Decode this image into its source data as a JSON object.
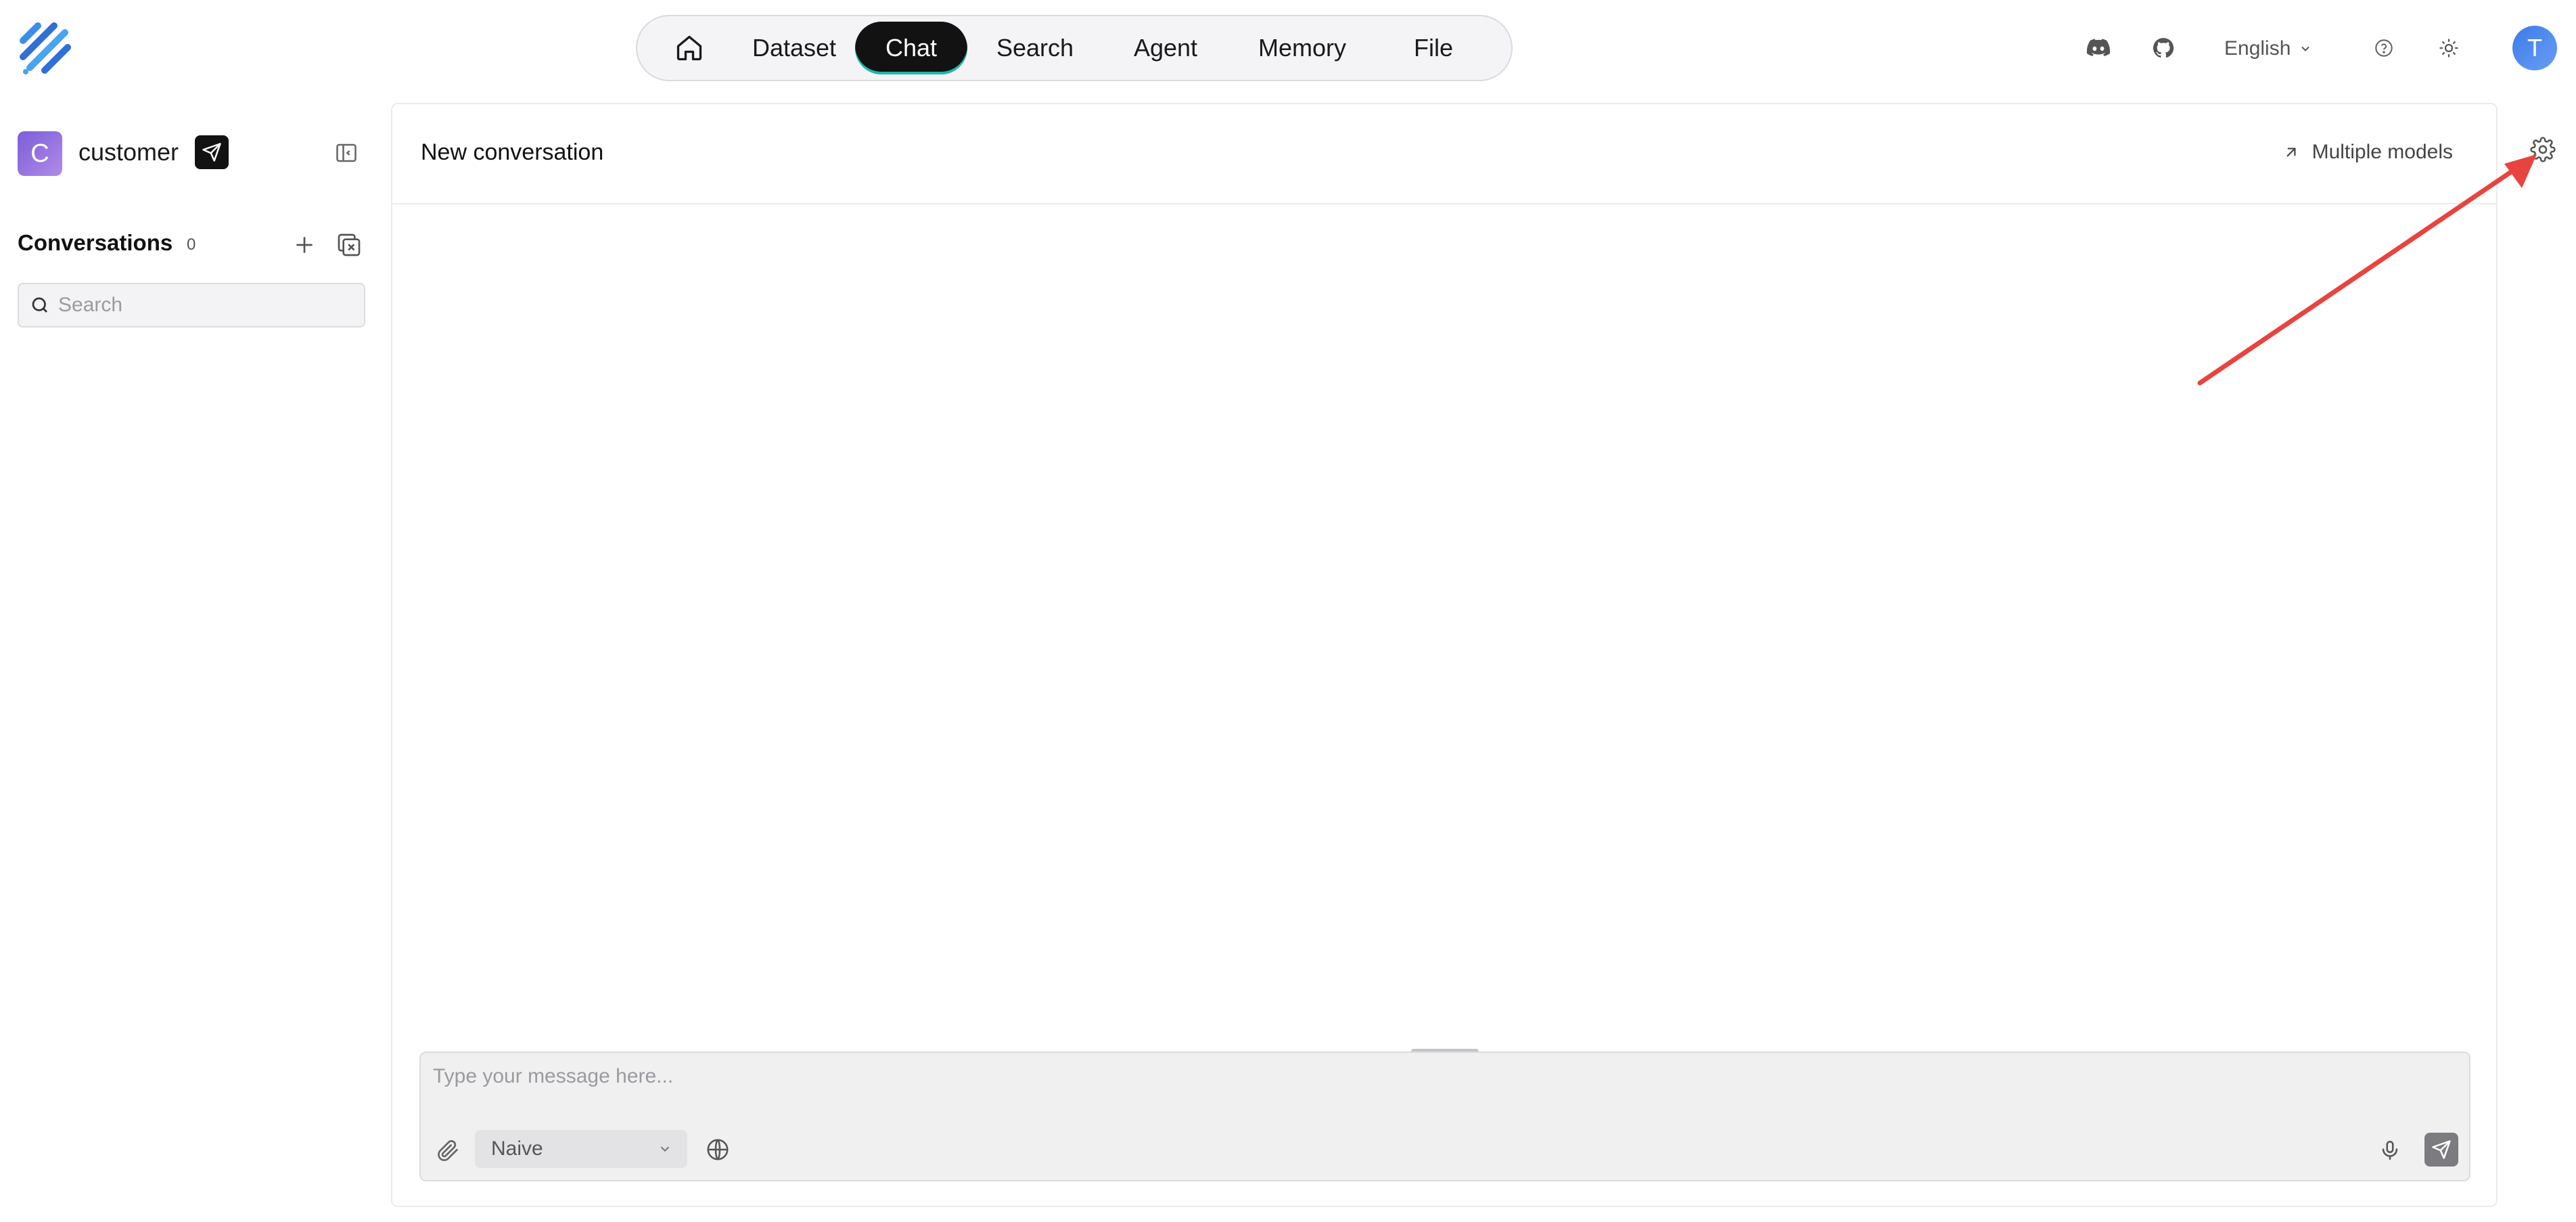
{
  "nav": {
    "items": [
      {
        "label": "Dataset"
      },
      {
        "label": "Chat",
        "active": true
      },
      {
        "label": "Search"
      },
      {
        "label": "Agent"
      },
      {
        "label": "Memory"
      },
      {
        "label": "File"
      }
    ],
    "home_icon": "home-icon"
  },
  "header_right": {
    "discord_icon": "discord-icon",
    "github_icon": "github-icon",
    "language": "English",
    "help_icon": "help-icon",
    "theme_icon": "sun-icon",
    "avatar_letter": "T"
  },
  "sidebar": {
    "app_initial": "C",
    "app_name": "customer",
    "conversations_title": "Conversations",
    "conversations_count": "0",
    "search_placeholder": "Search"
  },
  "main": {
    "conversation_title": "New conversation",
    "multiple_models_label": "Multiple models",
    "composer_placeholder": "Type your message here...",
    "mode_value": "Naive"
  },
  "colors": {
    "nav_active_bg": "#121212",
    "nav_active_underline": "#19b9ad",
    "annotation_arrow": "#e8443f",
    "avatar_blue": "#3b7be8",
    "app_avatar_purple": "#7b5ed8"
  }
}
